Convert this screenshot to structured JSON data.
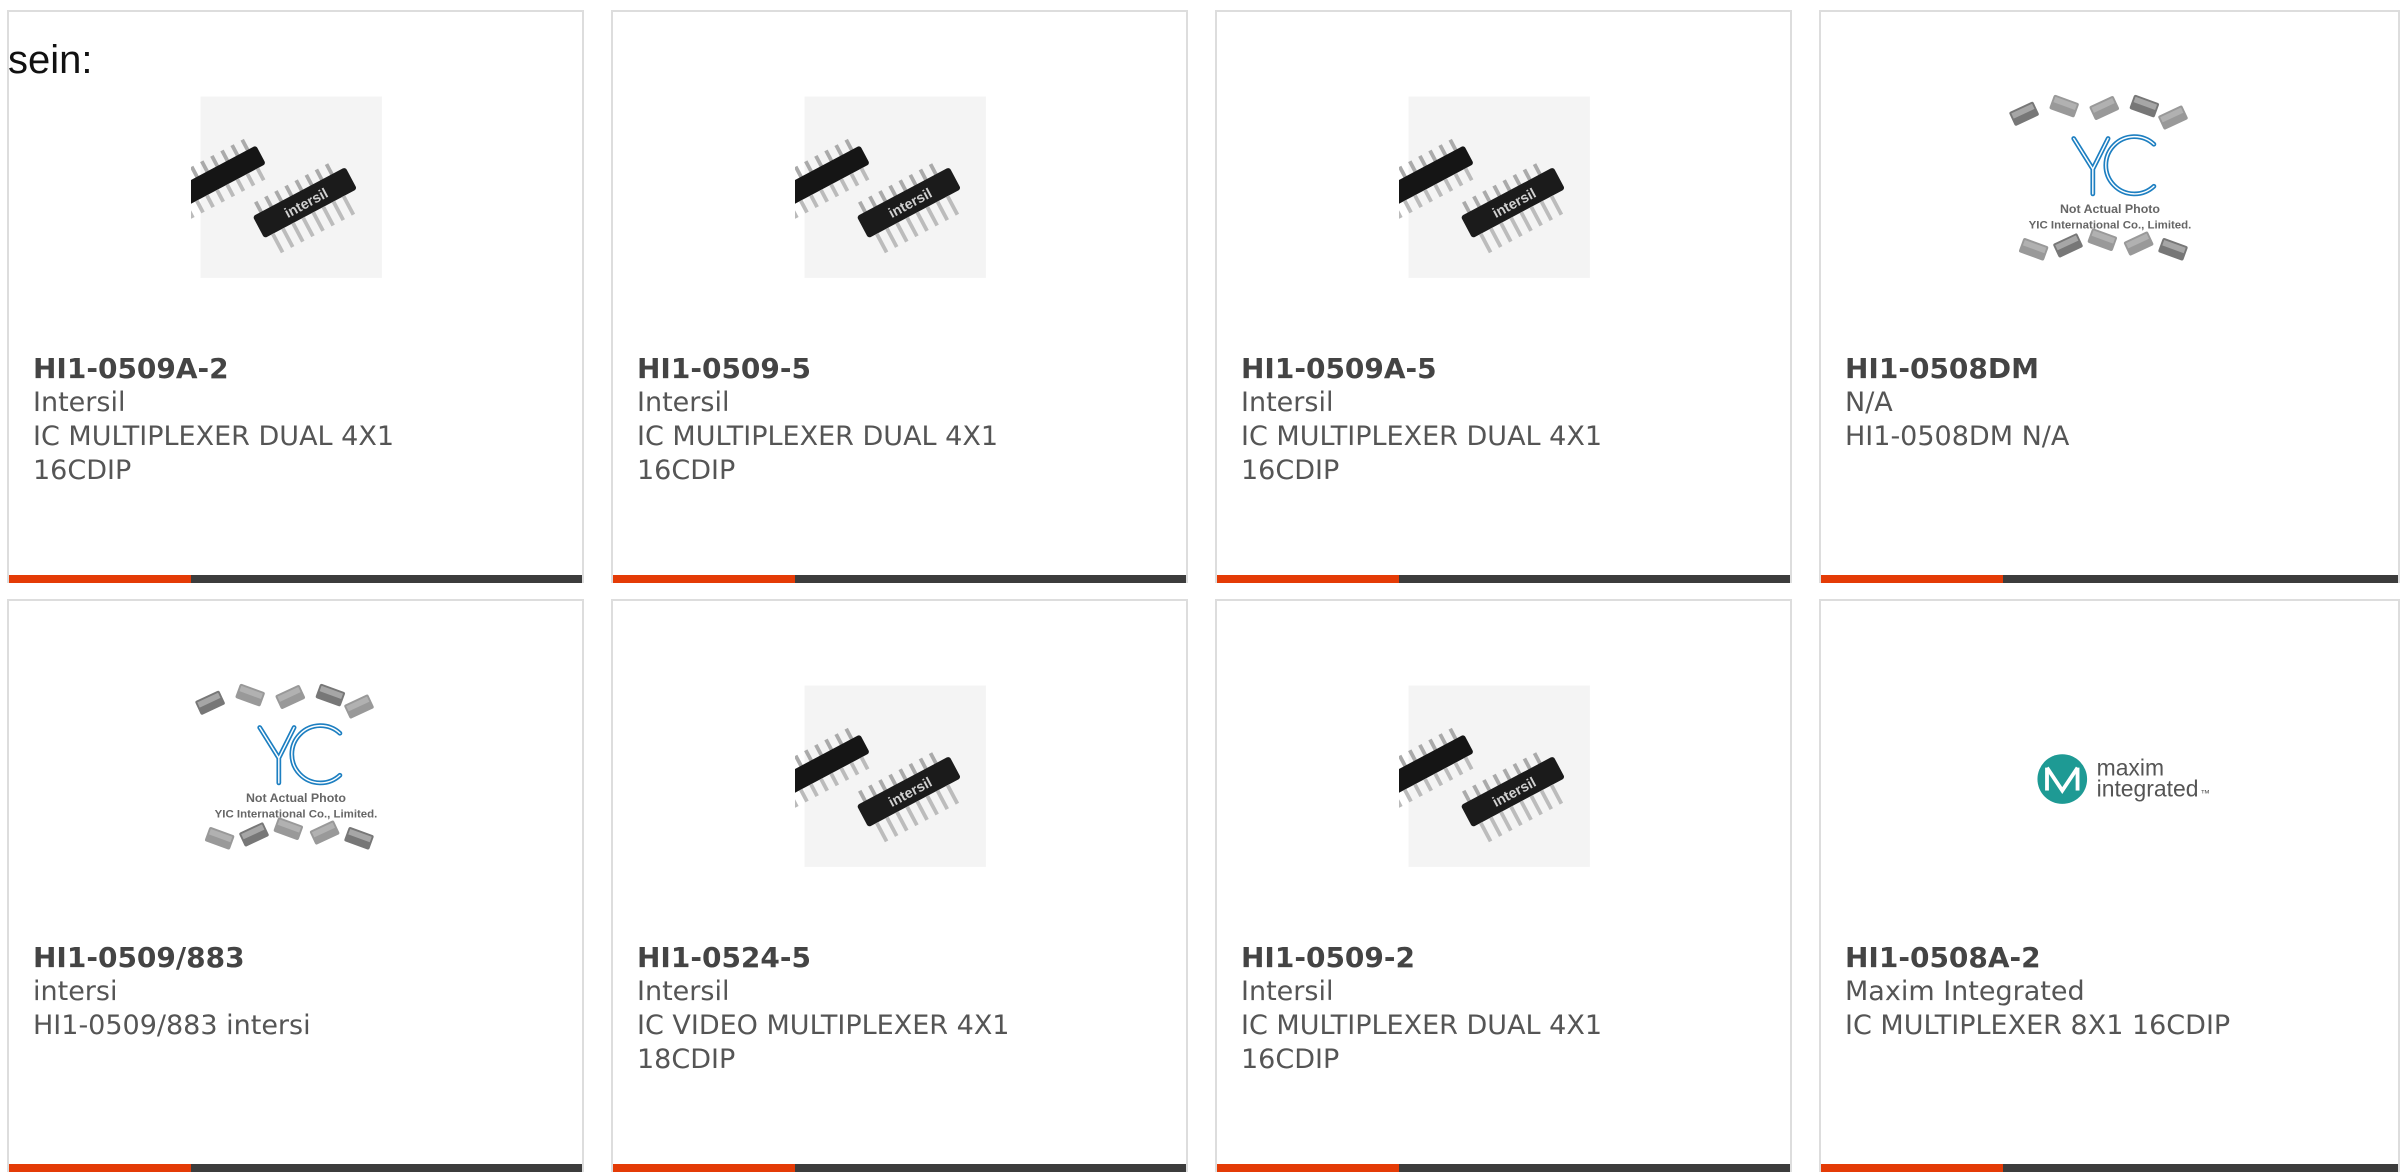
{
  "page": {
    "label": "sein:"
  },
  "products": [
    {
      "part": "HI1-0509A-2",
      "manufacturer": "Intersil",
      "description": "IC MULTIPLEXER DUAL 4X1\n16CDIP",
      "image": "intersil-chip"
    },
    {
      "part": "HI1-0509-5",
      "manufacturer": "Intersil",
      "description": "IC MULTIPLEXER DUAL 4X1\n16CDIP",
      "image": "intersil-chip"
    },
    {
      "part": "HI1-0509A-5",
      "manufacturer": "Intersil",
      "description": "IC MULTIPLEXER DUAL 4X1\n16CDIP",
      "image": "intersil-chip"
    },
    {
      "part": "HI1-0508DM",
      "manufacturer": "N/A",
      "description": "HI1-0508DM N/A",
      "image": "yic-placeholder",
      "image_text": [
        "Not Actual Photo",
        "YIC International Co., Limited."
      ]
    },
    {
      "part": "HI1-0509/883",
      "manufacturer": "intersi",
      "description": "HI1-0509/883 intersi",
      "image": "yic-placeholder",
      "image_text": [
        "Not Actual Photo",
        "YIC International Co., Limited."
      ]
    },
    {
      "part": "HI1-0524-5",
      "manufacturer": "Intersil",
      "description": "IC VIDEO MULTIPLEXER 4X1\n18CDIP",
      "image": "intersil-chip"
    },
    {
      "part": "HI1-0509-2",
      "manufacturer": "Intersil",
      "description": "IC MULTIPLEXER DUAL 4X1\n16CDIP",
      "image": "intersil-chip"
    },
    {
      "part": "HI1-0508A-2",
      "manufacturer": "Maxim Integrated",
      "description": "IC MULTIPLEXER 8X1 16CDIP",
      "image": "maxim-logo",
      "image_text": [
        "maxim",
        "integrated",
        "™"
      ]
    }
  ],
  "colors": {
    "accent": "#e43b06",
    "bar": "#3c3c3c",
    "text": "#555555",
    "border": "#dddddd",
    "yic_blue": "#1d7fc1",
    "maxim_teal": "#1e9a94"
  }
}
